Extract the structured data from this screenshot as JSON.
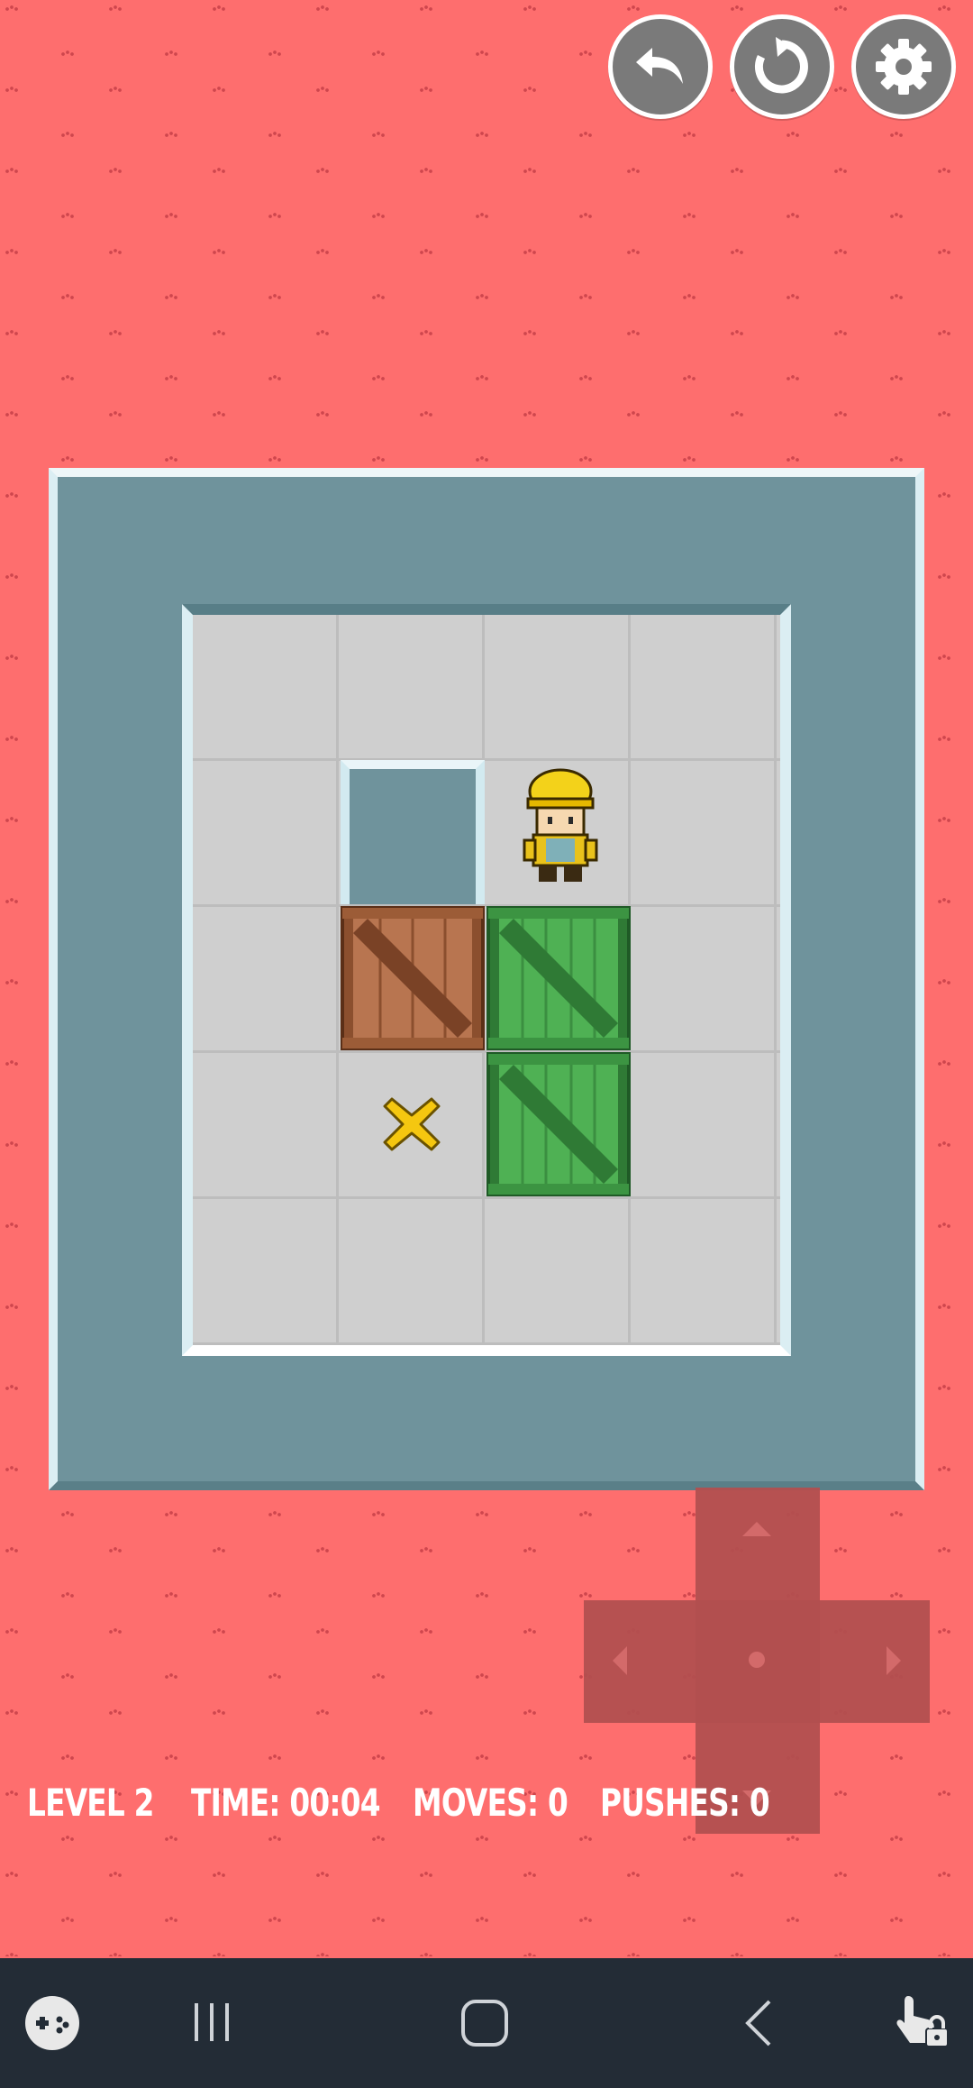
{
  "hud": {
    "level": "LEVEL 2",
    "time": "TIME: 00:04",
    "moves": "MOVES: 0",
    "pushes": "PUSHES: 0"
  },
  "toolbar": {
    "undo": "undo-icon",
    "restart": "restart-icon",
    "settings": "gear-icon"
  },
  "board": {
    "columns": 4,
    "rows": 5,
    "player": {
      "row": 2,
      "col": 3
    },
    "wall": {
      "row": 2,
      "col": 2
    },
    "crates": [
      {
        "row": 3,
        "col": 2,
        "on_target": false
      },
      {
        "row": 3,
        "col": 3,
        "on_target": true
      },
      {
        "row": 4,
        "col": 3,
        "on_target": true
      }
    ],
    "targets": [
      {
        "row": 4,
        "col": 2
      }
    ]
  },
  "colors": {
    "background": "#fe6e6e",
    "wall": "#6f939c",
    "floor": "#cfcfcf",
    "crate_brown": "#a8643f",
    "crate_green": "#46a84c",
    "target": "#f2c200"
  },
  "navbar": {
    "icons": [
      "game-launcher-icon",
      "recent-apps-icon",
      "home-icon",
      "back-icon",
      "touch-lock-icon"
    ]
  }
}
